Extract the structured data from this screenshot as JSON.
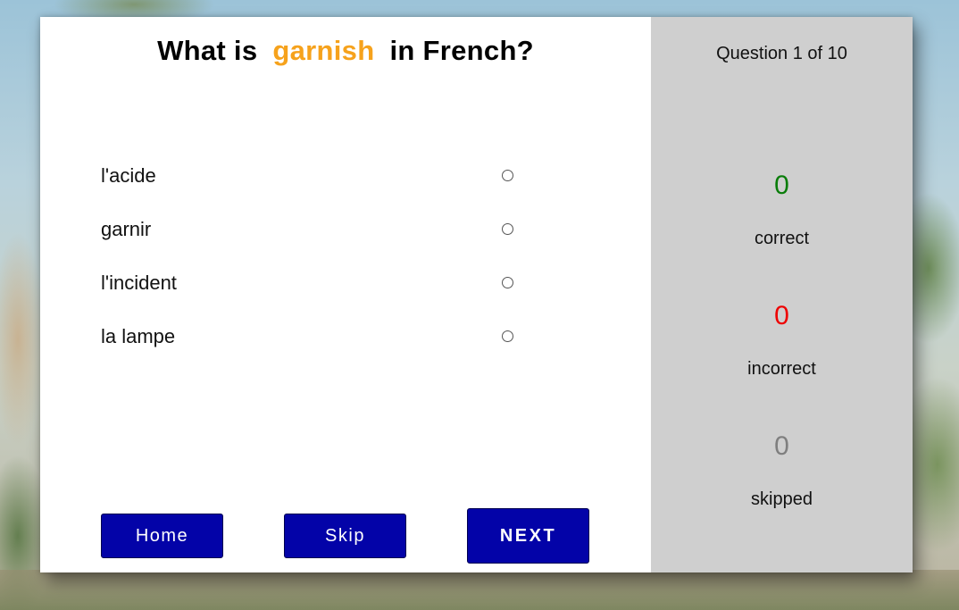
{
  "question": {
    "prefix": "What is",
    "word": "garnish",
    "suffix": "in French?"
  },
  "answers": [
    {
      "label": "l'acide",
      "selected": false
    },
    {
      "label": "garnir",
      "selected": false
    },
    {
      "label": "l'incident",
      "selected": false
    },
    {
      "label": "la lampe",
      "selected": false
    }
  ],
  "buttons": {
    "home": "Home",
    "skip": "Skip",
    "next": "NEXT"
  },
  "progress": "Question 1 of 10",
  "stats": {
    "correct": {
      "value": "0",
      "label": "correct"
    },
    "incorrect": {
      "value": "0",
      "label": "incorrect"
    },
    "skipped": {
      "value": "0",
      "label": "skipped"
    }
  },
  "colors": {
    "highlight_word": "#f6a21c",
    "button": "#0303a8",
    "correct": "#0a7d0a",
    "incorrect": "#ee0000",
    "skipped": "#7f7f7f",
    "sidebar": "#cfcfcf"
  }
}
